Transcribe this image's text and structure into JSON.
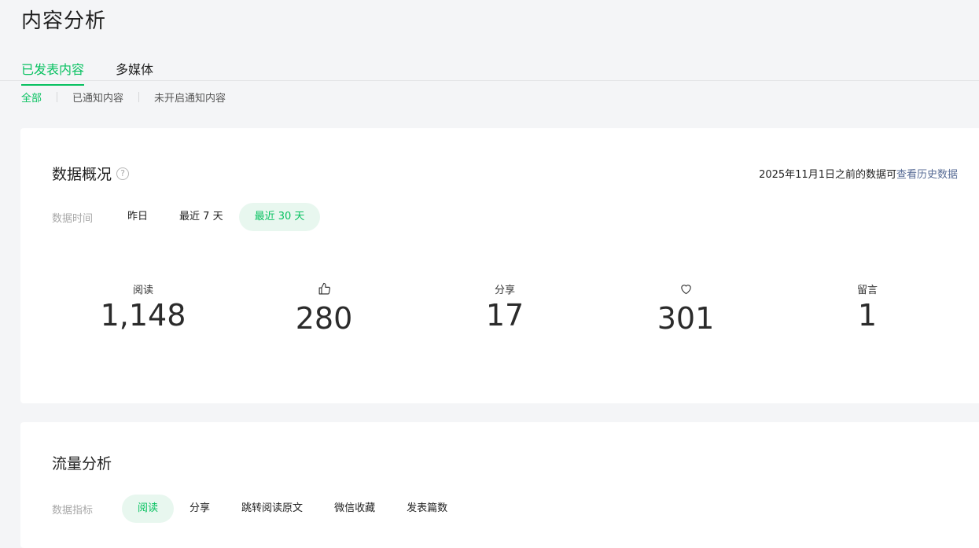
{
  "page": {
    "title": "内容分析"
  },
  "tabs": [
    {
      "label": "已发表内容",
      "active": true
    },
    {
      "label": "多媒体",
      "active": false
    }
  ],
  "subtabs": [
    {
      "label": "全部",
      "active": true
    },
    {
      "label": "已通知内容",
      "active": false
    },
    {
      "label": "未开启通知内容",
      "active": false
    }
  ],
  "overview": {
    "title": "数据概况",
    "help_icon": "question-circle-icon",
    "history_prefix": "2025年11月1日之前的数据可",
    "history_link": "查看历史数据",
    "time_label": "数据时间",
    "time_options": [
      {
        "label": "昨日",
        "active": false
      },
      {
        "label": "最近 7 天",
        "active": false
      },
      {
        "label": "最近 30 天",
        "active": true
      }
    ],
    "metrics": [
      {
        "label": "阅读",
        "icon": null,
        "value": "1,148"
      },
      {
        "label": "",
        "icon": "thumbs-up-icon",
        "value": "280"
      },
      {
        "label": "分享",
        "icon": null,
        "value": "17"
      },
      {
        "label": "",
        "icon": "heart-icon",
        "value": "301"
      },
      {
        "label": "留言",
        "icon": null,
        "value": "1"
      }
    ]
  },
  "traffic": {
    "title": "流量分析",
    "metric_label": "数据指标",
    "metric_options": [
      {
        "label": "阅读",
        "active": true
      },
      {
        "label": "分享",
        "active": false
      },
      {
        "label": "跳转阅读原文",
        "active": false
      },
      {
        "label": "微信收藏",
        "active": false
      },
      {
        "label": "发表篇数",
        "active": false
      }
    ]
  },
  "colors": {
    "accent": "#07c160",
    "accent_bg": "#e8f7ef",
    "link": "#576b95",
    "page_bg": "#f4f5f7"
  }
}
